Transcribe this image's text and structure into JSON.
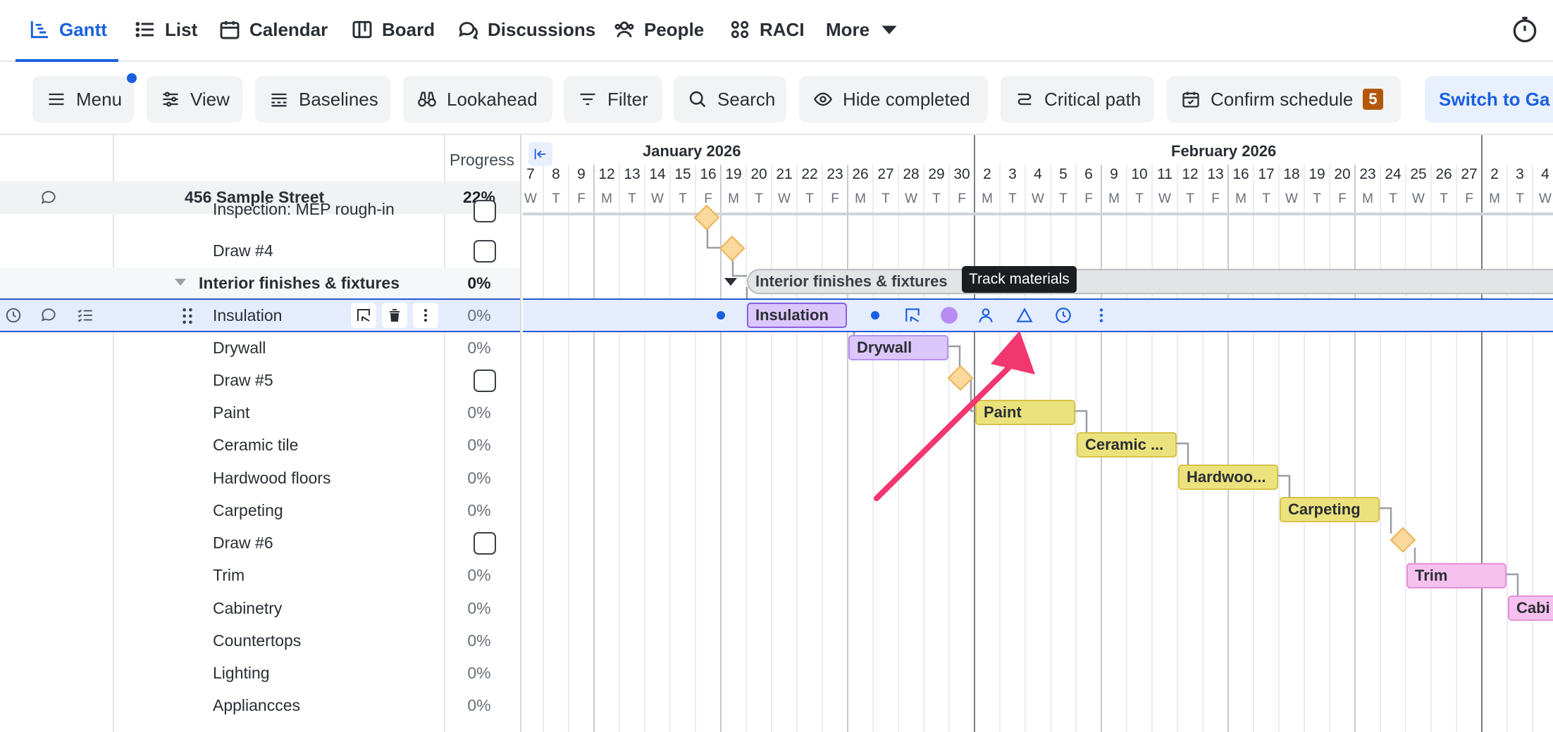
{
  "nav": {
    "tabs": [
      {
        "label": "Gantt",
        "icon": "gantt-icon"
      },
      {
        "label": "List",
        "icon": "list-icon"
      },
      {
        "label": "Calendar",
        "icon": "calendar-icon"
      },
      {
        "label": "Board",
        "icon": "board-icon"
      },
      {
        "label": "Discussions",
        "icon": "discussions-icon"
      },
      {
        "label": "People",
        "icon": "people-icon"
      },
      {
        "label": "RACI",
        "icon": "raci-icon"
      },
      {
        "label": "More",
        "icon": "chevron-down-icon"
      }
    ],
    "active_tab": "Gantt"
  },
  "toolbar": {
    "menu": "Menu",
    "view": "View",
    "baselines": "Baselines",
    "lookahead": "Lookahead",
    "filter": "Filter",
    "search": "Search",
    "hide_completed": "Hide completed",
    "critical_path": "Critical path",
    "confirm_schedule": "Confirm schedule",
    "confirm_count": "5",
    "switch": "Switch to Ga"
  },
  "table": {
    "progress_header": "Progress",
    "project": {
      "name": "456 Sample Street",
      "progress": "22%"
    },
    "rows": [
      {
        "name": "Inspection: MEP rough-in",
        "type": "milestone"
      },
      {
        "name": "Draw #4",
        "type": "milestone"
      },
      {
        "name": "Interior finishes & fixtures",
        "progress": "0%",
        "type": "group"
      },
      {
        "name": "Insulation",
        "progress": "0%",
        "type": "task"
      },
      {
        "name": "Drywall",
        "progress": "0%",
        "type": "task"
      },
      {
        "name": "Draw #5",
        "type": "milestone"
      },
      {
        "name": "Paint",
        "progress": "0%",
        "type": "task"
      },
      {
        "name": "Ceramic tile",
        "progress": "0%",
        "type": "task"
      },
      {
        "name": "Hardwood floors",
        "progress": "0%",
        "type": "task"
      },
      {
        "name": "Carpeting",
        "progress": "0%",
        "type": "task"
      },
      {
        "name": "Draw #6",
        "type": "milestone"
      },
      {
        "name": "Trim",
        "progress": "0%",
        "type": "task"
      },
      {
        "name": "Cabinetry",
        "progress": "0%",
        "type": "task"
      },
      {
        "name": "Countertops",
        "progress": "0%",
        "type": "task"
      },
      {
        "name": "Lighting",
        "progress": "0%",
        "type": "task"
      },
      {
        "name": "Appliancces",
        "progress": "0%",
        "type": "task"
      }
    ]
  },
  "timeline": {
    "months": [
      "January 2026",
      "February 2026"
    ],
    "days": [
      "7",
      "8",
      "9",
      "12",
      "13",
      "14",
      "15",
      "16",
      "19",
      "20",
      "21",
      "22",
      "23",
      "26",
      "27",
      "28",
      "29",
      "30",
      "2",
      "3",
      "4",
      "5",
      "6",
      "9",
      "10",
      "11",
      "12",
      "13",
      "16",
      "17",
      "18",
      "19",
      "20",
      "23",
      "24",
      "25",
      "26",
      "27",
      "2",
      "3",
      "4"
    ],
    "weekdays": [
      "W",
      "T",
      "F",
      "M",
      "T",
      "W",
      "T",
      "F",
      "M",
      "T",
      "W",
      "T",
      "F",
      "M",
      "T",
      "W",
      "T",
      "F",
      "M",
      "T",
      "W",
      "T",
      "F",
      "M",
      "T",
      "W",
      "T",
      "F",
      "M",
      "T",
      "W",
      "T",
      "F",
      "M",
      "T",
      "W",
      "T",
      "F",
      "M",
      "T",
      "W"
    ]
  },
  "gantt_bars": {
    "group": "Interior finishes & fixtures",
    "insulation": "Insulation",
    "drywall": "Drywall",
    "paint": "Paint",
    "ceramic": "Ceramic ...",
    "hardwood": "Hardwoo...",
    "carpeting": "Carpeting",
    "trim": "Trim",
    "cabinetry": "Cabi"
  },
  "tooltip": "Track materials",
  "colors": {
    "accent": "#1a5fe0",
    "task_purple": "#dcc7fb",
    "task_yellow": "#ece27d",
    "task_pink": "#f6c1ee",
    "milestone": "#fbd89c",
    "annotation_arrow": "#f2366f",
    "badge": "#b3580b"
  }
}
